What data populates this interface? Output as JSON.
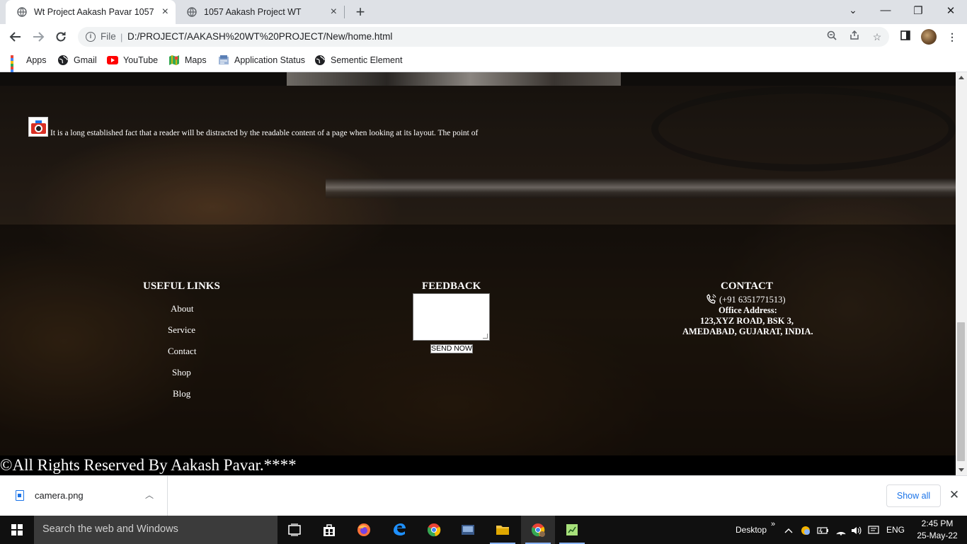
{
  "browser": {
    "tabs": [
      {
        "title": "Wt Project Aakash Pavar 1057",
        "active": true
      },
      {
        "title": "1057 Aakash Project WT",
        "active": false
      }
    ],
    "new_tab": "+",
    "window_controls": {
      "minimize": "—",
      "maximize": "❐",
      "close": "✕",
      "tab_search": "⌄"
    },
    "address": {
      "scheme_label": "File",
      "url": "D:/PROJECT/AAKASH%20WT%20PROJECT/New/home.html"
    },
    "bookmarks": [
      "Apps",
      "Gmail",
      "YouTube",
      "Maps",
      "Application Status",
      "Sementic Element"
    ]
  },
  "page": {
    "intro_text": "It is a long established fact that a reader will be distracted by the readable content of a page when looking at its layout. The point of",
    "footer": {
      "useful_links": {
        "title": "USEFUL LINKS",
        "links": [
          "About",
          "Service",
          "Contact",
          "Shop",
          "Blog"
        ]
      },
      "feedback": {
        "title": "FEEDBACK",
        "textarea_value": "",
        "button": "SEND NOW"
      },
      "contact": {
        "title": "CONTACT",
        "phone": "(+91 6351771513)",
        "address_label": "Office Address:",
        "address_line1": "123,XYZ ROAD, BSK 3,",
        "address_line2": "AMEDABAD, GUJARAT, INDIA."
      }
    },
    "copyright": "©All Rights Reserved By Aakash Pavar.****"
  },
  "downloads": {
    "file": "camera.png",
    "show_all": "Show all",
    "close": "✕"
  },
  "taskbar": {
    "search_placeholder": "Search the web and Windows",
    "desktop_label": "Desktop",
    "language": "ENG",
    "time": "2:45 PM",
    "date": "25-May-22"
  },
  "colors": {
    "chrome_tabstrip": "#dee1e6",
    "accent_blue": "#1a73e8",
    "taskbar": "#101010",
    "footer_text": "#ffffff"
  }
}
